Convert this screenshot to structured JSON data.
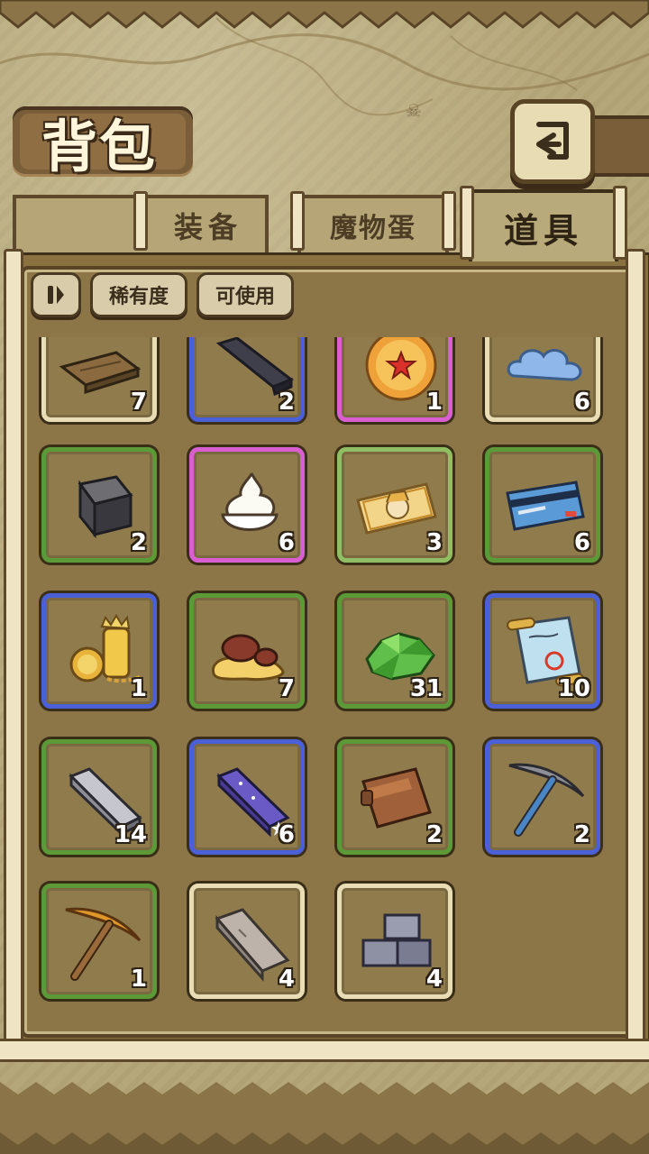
{
  "title": "背包",
  "tabs": [
    {
      "label": "装备",
      "active": false
    },
    {
      "label": "魔物蛋",
      "active": false
    },
    {
      "label": "道具",
      "active": true
    }
  ],
  "filters": {
    "toggle_icon": "pause-filter-icon",
    "rarity_label": "稀有度",
    "usable_label": "可使用"
  },
  "colors": {
    "rarity_green": "#5b9a36",
    "rarity_blue": "#4b5fd6",
    "rarity_pink": "#d95fd0",
    "rarity_cream": "#e9ddb5"
  },
  "items": [
    {
      "name": "wooden-plank",
      "rarity": "cream",
      "count": "7"
    },
    {
      "name": "dark-metal-ingot",
      "rarity": "blue",
      "count": "2"
    },
    {
      "name": "star-medal",
      "rarity": "pink",
      "count": "1"
    },
    {
      "name": "blue-cloud",
      "rarity": "cream",
      "count": "6"
    },
    {
      "name": "iron-block",
      "rarity": "green",
      "count": "2"
    },
    {
      "name": "whipped-cream",
      "rarity": "pink",
      "count": "6"
    },
    {
      "name": "character-ticket",
      "rarity": "lightgreen",
      "count": "3"
    },
    {
      "name": "bank-card",
      "rarity": "green",
      "count": "6"
    },
    {
      "name": "gold-trophy-coins",
      "rarity": "blue",
      "count": "1"
    },
    {
      "name": "mushroom-puddle",
      "rarity": "green",
      "count": "7"
    },
    {
      "name": "green-crystals",
      "rarity": "green",
      "count": "31"
    },
    {
      "name": "treasure-scroll",
      "rarity": "blue",
      "count": "10"
    },
    {
      "name": "silver-ingot",
      "rarity": "green",
      "count": "14"
    },
    {
      "name": "starry-ingot",
      "rarity": "blue",
      "count": "6"
    },
    {
      "name": "leather-wallet",
      "rarity": "green",
      "count": "2"
    },
    {
      "name": "steel-pickaxe",
      "rarity": "blue",
      "count": "2"
    },
    {
      "name": "copper-pickaxe",
      "rarity": "green",
      "count": "1"
    },
    {
      "name": "stone-slab",
      "rarity": "cream",
      "count": "4"
    },
    {
      "name": "stone-bricks",
      "rarity": "cream",
      "count": "4"
    }
  ]
}
